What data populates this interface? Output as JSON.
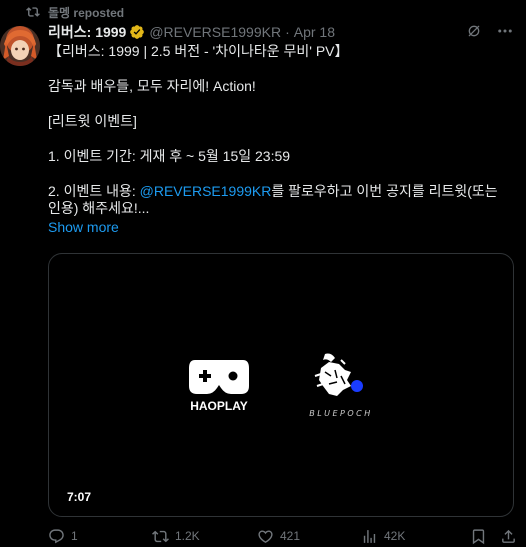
{
  "repost_banner": {
    "text": "돌멩 reposted",
    "icon": "repost-icon"
  },
  "tweet": {
    "display_name": "리버스: 1999",
    "verified_icon": "verified-badge-icon",
    "handle": "@REVERSE1999KR",
    "separator": "·",
    "time": "Apr 18",
    "header_icons": [
      "grok-icon",
      "more-icon"
    ],
    "lines": {
      "l1": "【리버스: 1999 | 2.5 버전 - '차이나타운 무비' PV】",
      "l2": "감독과 배우들, 모두 자리에! Action!",
      "l3": "[리트윗 이벤트]",
      "l4": "1. 이벤트 기간: 게재 후 ~ 5월 15일 23:59",
      "l5_prefix": "2. 이벤트 내용: ",
      "l5_mention": "@REVERSE1999KR",
      "l5_suffix": "를 팔로우하고 이번 공지를 리트윗(또는 인용) 해주세요!..."
    },
    "show_more": "Show more",
    "media": {
      "logo_left_text": "HAOPLAY",
      "logo_right_text": "BLUEPOCH",
      "duration": "7:07",
      "accent_color": "#1a3cff"
    },
    "actions": {
      "replies": "1",
      "reposts": "1.2K",
      "likes": "421",
      "views": "42K"
    }
  }
}
